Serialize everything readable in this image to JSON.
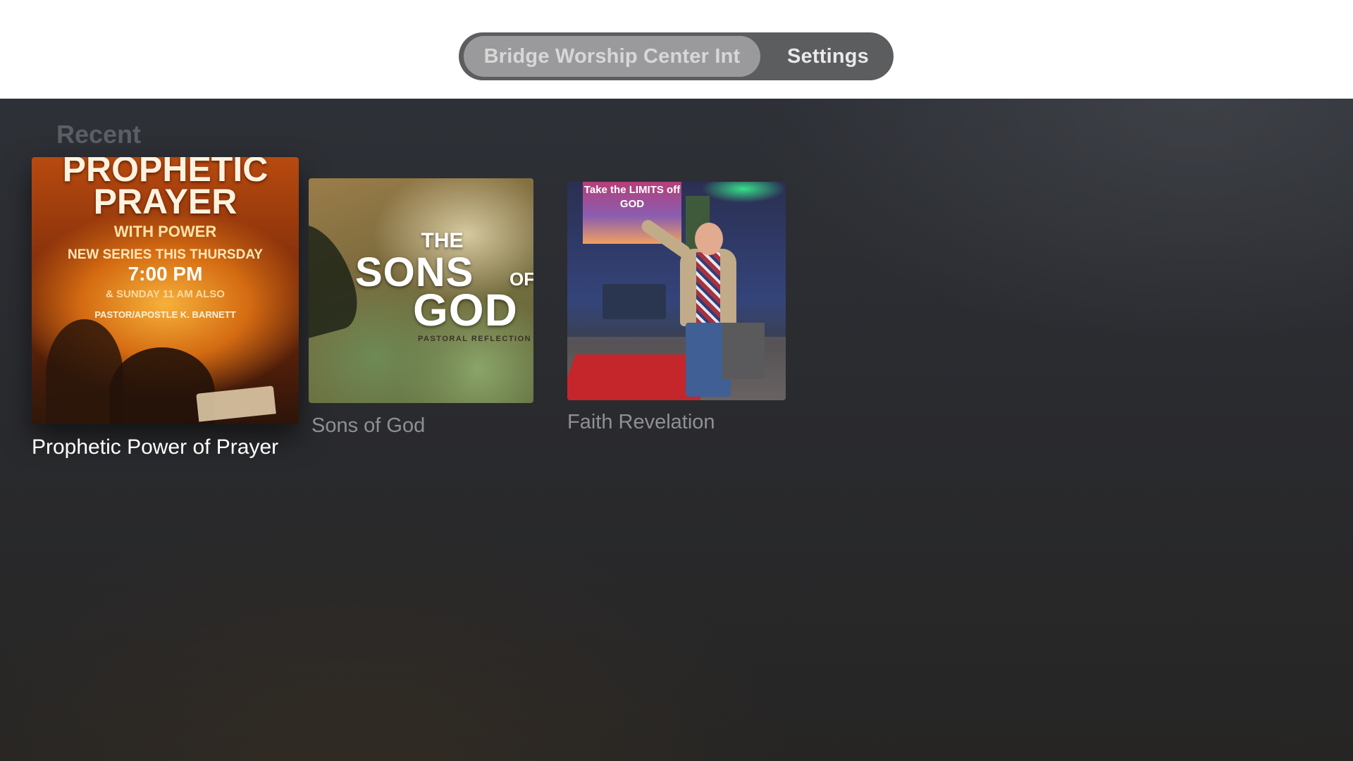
{
  "tabbar": {
    "tabs": [
      {
        "label": "Bridge Worship Center Int",
        "selected": true
      },
      {
        "label": "Settings",
        "selected": false
      }
    ]
  },
  "section": {
    "title": "Recent"
  },
  "items": [
    {
      "title": "Prophetic Power of Prayer",
      "focused": true,
      "poster": {
        "line1": "PROPHETIC",
        "line2": "PRAYER",
        "line3": "WITH POWER",
        "line4": "NEW SERIES THIS THURSDAY",
        "line5": "7:00 PM",
        "line6": "& SUNDAY 11 AM ALSO",
        "line7": "PASTOR/APOSTLE K. BARNETT"
      }
    },
    {
      "title": "Sons of God",
      "focused": false,
      "poster": {
        "the": "THE",
        "sons": "SONS",
        "of": "OF",
        "god": "GOD",
        "subtitle": "PASTORAL REFLECTION"
      }
    },
    {
      "title": "Faith Revelation",
      "focused": false,
      "poster": {
        "screen_text": "Take the LIMITS off GOD"
      }
    }
  ],
  "colors": {
    "tabbar_bg": "#5c5d5f",
    "tab_selected_bg": "#9a9a9c",
    "background": "#2a2b2f",
    "caption_focused": "#ffffff",
    "caption_unfocused": "#8e9095"
  }
}
